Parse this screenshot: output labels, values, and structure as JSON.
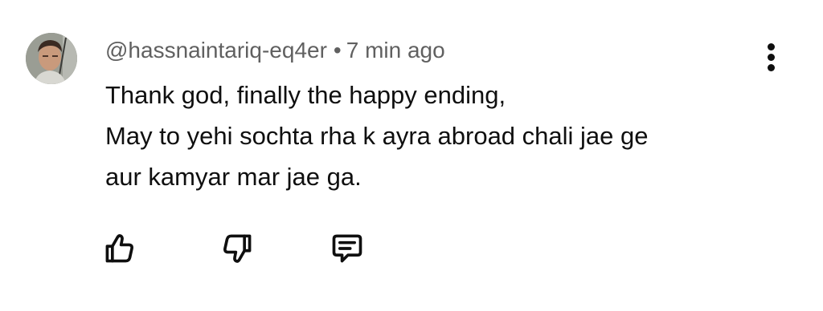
{
  "comment": {
    "author": "@hassnaintariq-eq4er",
    "separator": "•",
    "timestamp": "7 min ago",
    "lines": [
      "Thank god, finally the happy ending,",
      "May to yehi sochta rha k ayra abroad chali jae ge",
      "aur kamyar mar jae ga."
    ]
  },
  "actions": {
    "like_icon": "thumbs-up-outline",
    "dislike_icon": "thumbs-down-outline",
    "reply_icon": "comment-bubble-outline",
    "menu_icon": "vertical-ellipsis"
  },
  "colors": {
    "meta_text": "#606060",
    "body_text": "#0f0f0f",
    "background": "#ffffff"
  }
}
